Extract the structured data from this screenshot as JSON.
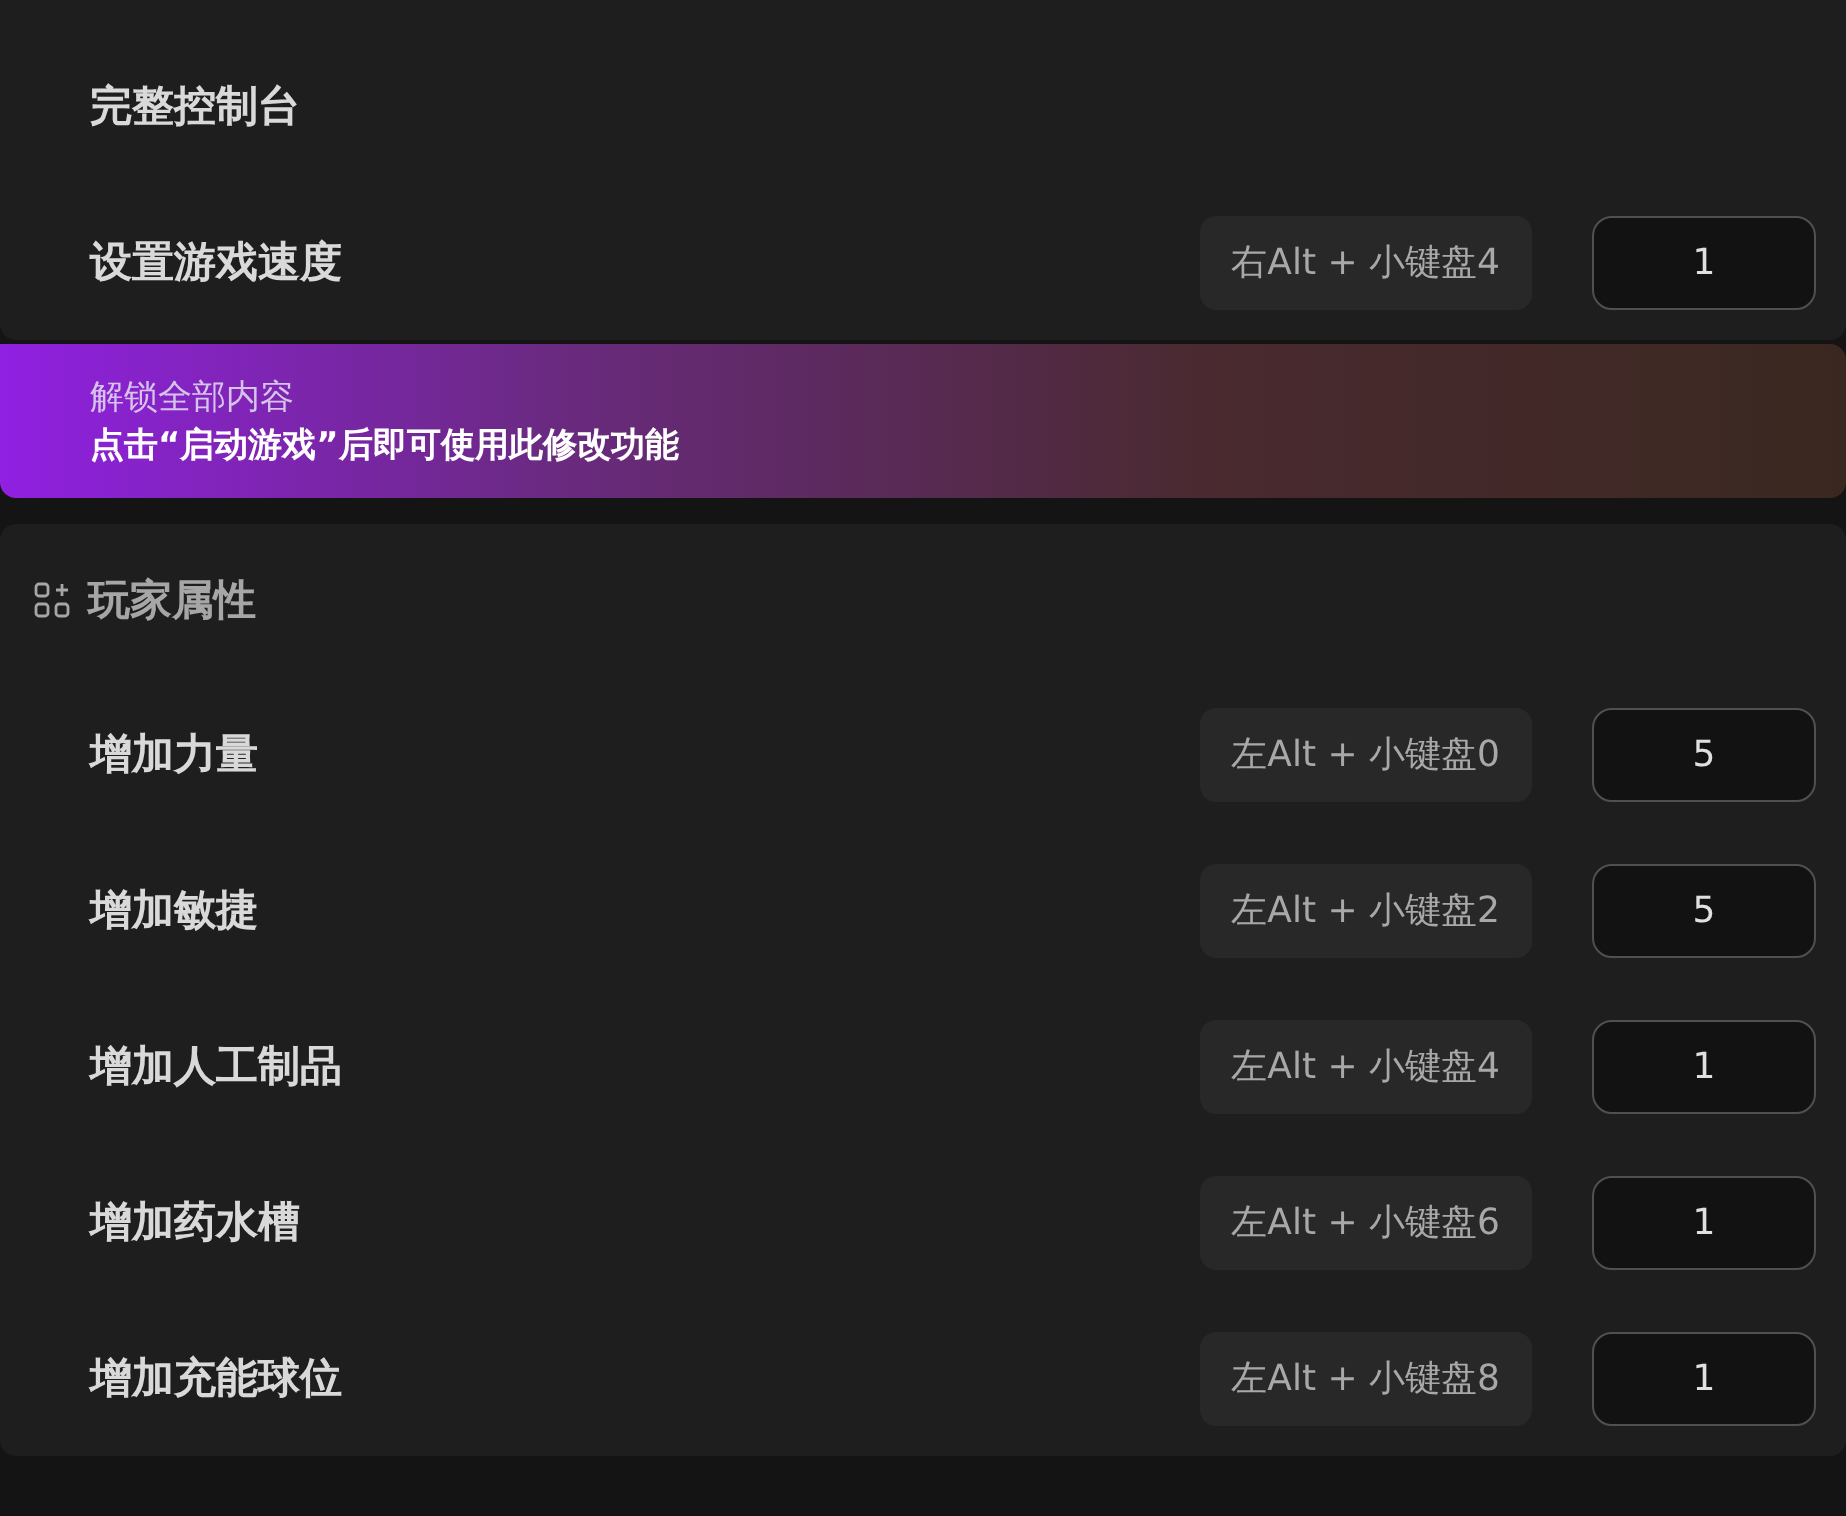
{
  "top_section": {
    "rows": [
      {
        "kind": "plain",
        "label": "完整控制台"
      },
      {
        "kind": "hotkey",
        "label": "设置游戏速度",
        "hotkey": "右Alt + 小键盘4",
        "value": "1"
      }
    ]
  },
  "unlock_banner": {
    "title": "解锁全部内容",
    "message": "点击“启动游戏”后即可使用此修改功能"
  },
  "player_section": {
    "title": "玩家属性",
    "rows": [
      {
        "kind": "hotkey",
        "label": "增加力量",
        "hotkey": "左Alt + 小键盘0",
        "value": "5"
      },
      {
        "kind": "hotkey",
        "label": "增加敏捷",
        "hotkey": "左Alt + 小键盘2",
        "value": "5"
      },
      {
        "kind": "hotkey",
        "label": "增加人工制品",
        "hotkey": "左Alt + 小键盘4",
        "value": "1"
      },
      {
        "kind": "hotkey",
        "label": "增加药水槽",
        "hotkey": "左Alt + 小键盘6",
        "value": "1"
      },
      {
        "kind": "hotkey",
        "label": "增加充能球位",
        "hotkey": "左Alt + 小键盘8",
        "value": "1"
      }
    ]
  }
}
